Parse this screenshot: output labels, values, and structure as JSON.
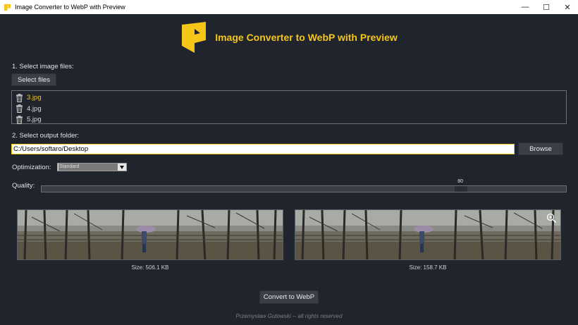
{
  "window": {
    "title": "Image Converter to WebP with Preview",
    "minimize": "—",
    "maximize": "☐",
    "close": "✕"
  },
  "header": {
    "title": "Image Converter to WebP with Preview",
    "logo_icon": "webp-logo-icon"
  },
  "step1": {
    "label": "1. Select image files:",
    "button": "Select files",
    "files": [
      {
        "name": "3.jpg",
        "selected": true
      },
      {
        "name": "4.jpg",
        "selected": false
      },
      {
        "name": "5.jpg",
        "selected": false
      }
    ]
  },
  "step2": {
    "label": "2. Select output folder:",
    "path": "C:/Users/softaro/Desktop",
    "browse": "Browse"
  },
  "optimization": {
    "label": "Optimization:",
    "value": "Standard"
  },
  "quality": {
    "label": "Quality:",
    "value": "80",
    "fraction": 0.8
  },
  "previews": {
    "original_size": "Size: 506.1 KB",
    "webp_size": "Size: 158.7 KB"
  },
  "convert_button": "Convert to WebP",
  "footer": "Przemysław Gutowski -- all rights reserved",
  "colors": {
    "accent": "#f5c518",
    "background": "#20242c",
    "button": "#3a3f47"
  }
}
